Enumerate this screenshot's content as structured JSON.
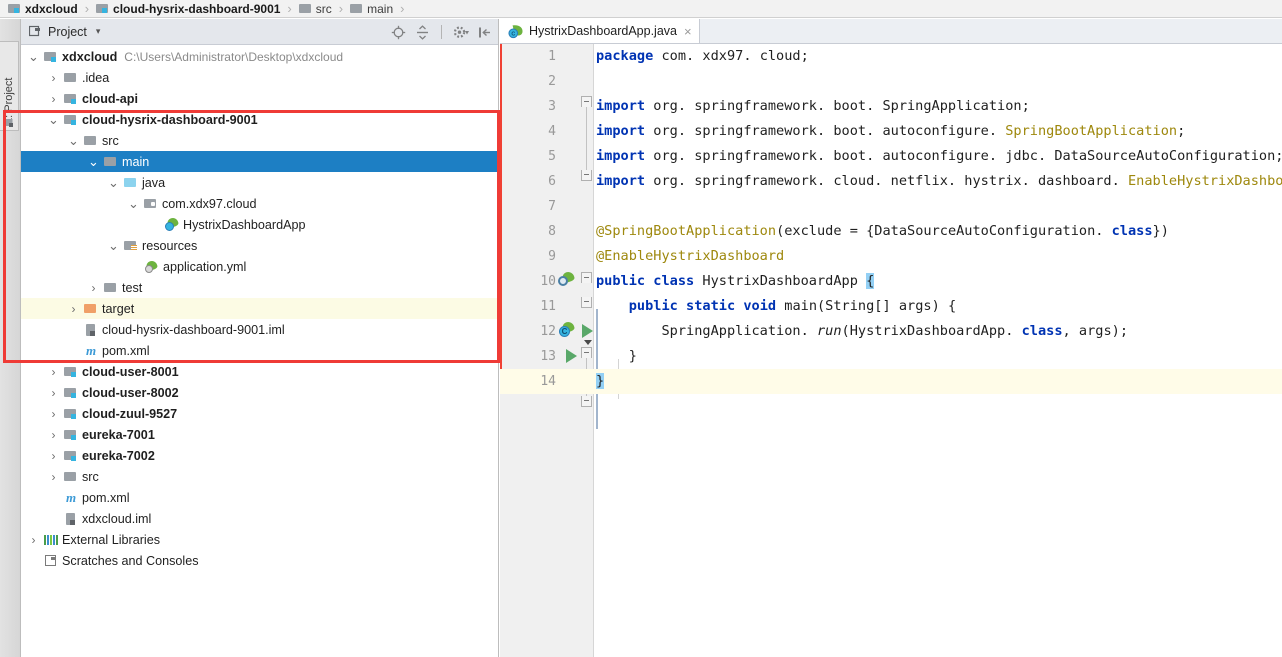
{
  "breadcrumb": {
    "name": "breadcrumb",
    "items": [
      {
        "label": "xdxcloud",
        "icon": "module-icon",
        "bold": true
      },
      {
        "label": "cloud-hysrix-dashboard-9001",
        "icon": "module-icon",
        "bold": true
      },
      {
        "label": "src",
        "icon": "folder-icon",
        "bold": false
      },
      {
        "label": "main",
        "icon": "folder-icon",
        "bold": false
      }
    ],
    "separator": "›"
  },
  "toolwindow_tab": {
    "label": "1: Project",
    "icon": "project-icon"
  },
  "project_panel": {
    "title": "Project",
    "caret": "▾",
    "tools": [
      {
        "name": "locate-icon",
        "title": "Select Opened File"
      },
      {
        "name": "collapse-all-icon",
        "title": "Collapse All"
      },
      {
        "name": "settings-gear-icon",
        "title": "Settings"
      },
      {
        "name": "hide-panel-icon",
        "title": "Hide"
      }
    ]
  },
  "tree": {
    "rows": [
      {
        "indent": 0,
        "arrow": "⌄",
        "icon": "module-icon",
        "label": "xdxcloud",
        "bold": true,
        "sub": "C:\\Users\\Administrator\\Desktop\\xdxcloud",
        "state": "normal"
      },
      {
        "indent": 1,
        "arrow": "›",
        "icon": "folder-icon",
        "label": ".idea",
        "bold": false,
        "sub": "",
        "state": "normal"
      },
      {
        "indent": 1,
        "arrow": "›",
        "icon": "module-icon",
        "label": "cloud-api",
        "bold": true,
        "sub": "",
        "state": "normal"
      },
      {
        "indent": 1,
        "arrow": "⌄",
        "icon": "module-icon",
        "label": "cloud-hysrix-dashboard-9001",
        "bold": true,
        "sub": "",
        "state": "normal"
      },
      {
        "indent": 2,
        "arrow": "⌄",
        "icon": "folder-icon",
        "label": "src",
        "bold": false,
        "sub": "",
        "state": "normal"
      },
      {
        "indent": 3,
        "arrow": "⌄",
        "icon": "folder-icon",
        "label": "main",
        "bold": false,
        "sub": "",
        "state": "selected"
      },
      {
        "indent": 4,
        "arrow": "⌄",
        "icon": "source-folder-icon",
        "label": "java",
        "bold": false,
        "sub": "",
        "state": "normal"
      },
      {
        "indent": 5,
        "arrow": "⌄",
        "icon": "package-icon",
        "label": "com.xdx97.cloud",
        "bold": false,
        "sub": "",
        "state": "normal"
      },
      {
        "indent": 6,
        "arrow": "",
        "icon": "spring-class-icon",
        "label": "HystrixDashboardApp",
        "bold": false,
        "sub": "",
        "state": "normal"
      },
      {
        "indent": 4,
        "arrow": "⌄",
        "icon": "resource-folder-icon",
        "label": "resources",
        "bold": false,
        "sub": "",
        "state": "normal"
      },
      {
        "indent": 5,
        "arrow": "",
        "icon": "spring-yml-icon",
        "label": "application.yml",
        "bold": false,
        "sub": "",
        "state": "normal"
      },
      {
        "indent": 3,
        "arrow": "›",
        "icon": "folder-icon",
        "label": "test",
        "bold": false,
        "sub": "",
        "state": "normal"
      },
      {
        "indent": 2,
        "arrow": "›",
        "icon": "target-folder-icon",
        "label": "target",
        "bold": false,
        "sub": "",
        "state": "highlight"
      },
      {
        "indent": 2,
        "arrow": "",
        "icon": "iml-file-icon",
        "label": "cloud-hysrix-dashboard-9001.iml",
        "bold": false,
        "sub": "",
        "state": "normal"
      },
      {
        "indent": 2,
        "arrow": "",
        "icon": "maven-file-icon",
        "label": "pom.xml",
        "bold": false,
        "sub": "",
        "state": "normal"
      },
      {
        "indent": 1,
        "arrow": "›",
        "icon": "module-icon",
        "label": "cloud-user-8001",
        "bold": true,
        "sub": "",
        "state": "normal"
      },
      {
        "indent": 1,
        "arrow": "›",
        "icon": "module-icon",
        "label": "cloud-user-8002",
        "bold": true,
        "sub": "",
        "state": "normal"
      },
      {
        "indent": 1,
        "arrow": "›",
        "icon": "module-icon",
        "label": "cloud-zuul-9527",
        "bold": true,
        "sub": "",
        "state": "normal"
      },
      {
        "indent": 1,
        "arrow": "›",
        "icon": "module-icon",
        "label": "eureka-7001",
        "bold": true,
        "sub": "",
        "state": "normal"
      },
      {
        "indent": 1,
        "arrow": "›",
        "icon": "module-icon",
        "label": "eureka-7002",
        "bold": true,
        "sub": "",
        "state": "normal"
      },
      {
        "indent": 1,
        "arrow": "›",
        "icon": "folder-icon",
        "label": "src",
        "bold": false,
        "sub": "",
        "state": "normal"
      },
      {
        "indent": 1,
        "arrow": "",
        "icon": "maven-file-icon",
        "label": "pom.xml",
        "bold": false,
        "sub": "",
        "state": "normal"
      },
      {
        "indent": 1,
        "arrow": "",
        "icon": "iml-file-icon",
        "label": "xdxcloud.iml",
        "bold": false,
        "sub": "",
        "state": "normal"
      },
      {
        "indent": 0,
        "arrow": "›",
        "icon": "external-libraries-icon",
        "label": "External Libraries",
        "bold": false,
        "sub": "",
        "state": "normal"
      },
      {
        "indent": 0,
        "arrow": "",
        "icon": "scratches-icon",
        "label": "Scratches and Consoles",
        "bold": false,
        "sub": "",
        "state": "normal"
      }
    ]
  },
  "annotation": {
    "name": "red-highlight-rectangle",
    "color": "#ef3b36"
  },
  "editor": {
    "tabs": [
      {
        "label": "HystrixDashboardApp.java",
        "icon": "spring-class-icon",
        "close": "×",
        "active": true
      }
    ],
    "current_line": 14,
    "lines": [
      {
        "no": 1,
        "segments": [
          {
            "t": "package",
            "c": "kw"
          },
          {
            "t": " com. xdx97. cloud;",
            "c": ""
          }
        ]
      },
      {
        "no": 2,
        "segments": []
      },
      {
        "no": 3,
        "segments": [
          {
            "t": "import",
            "c": "kw"
          },
          {
            "t": " org. springframework. boot. SpringApplication;",
            "c": ""
          }
        ]
      },
      {
        "no": 4,
        "segments": [
          {
            "t": "import",
            "c": "kw"
          },
          {
            "t": " org. springframework. boot. autoconfigure. ",
            "c": ""
          },
          {
            "t": "SpringBootApplication",
            "c": "cls"
          },
          {
            "t": ";",
            "c": ""
          }
        ]
      },
      {
        "no": 5,
        "segments": [
          {
            "t": "import",
            "c": "kw"
          },
          {
            "t": " org. springframework. boot. autoconfigure. jdbc. DataSourceAutoConfiguration;",
            "c": ""
          }
        ]
      },
      {
        "no": 6,
        "segments": [
          {
            "t": "import",
            "c": "kw"
          },
          {
            "t": " org. springframework. cloud. netflix. hystrix. dashboard. ",
            "c": ""
          },
          {
            "t": "EnableHystrixDashboard",
            "c": "cls"
          },
          {
            "t": ";",
            "c": ""
          }
        ]
      },
      {
        "no": 7,
        "segments": []
      },
      {
        "no": 8,
        "segments": [
          {
            "t": "@SpringBootApplication",
            "c": "ann"
          },
          {
            "t": "(exclude = ",
            "c": ""
          },
          {
            "t": "{",
            "c": "brace"
          },
          {
            "t": "DataSourceAutoConfiguration. ",
            "c": ""
          },
          {
            "t": "class",
            "c": "kw"
          },
          {
            "t": "}",
            "c": "brace"
          },
          {
            "t": ")",
            "c": ""
          }
        ]
      },
      {
        "no": 9,
        "segments": [
          {
            "t": "@EnableHystrixDashboard",
            "c": "ann"
          }
        ]
      },
      {
        "no": 10,
        "segments": [
          {
            "t": "public class",
            "c": "kw"
          },
          {
            "t": " HystrixDashboardApp ",
            "c": ""
          },
          {
            "t": "{",
            "c": "brace-hl"
          }
        ]
      },
      {
        "no": 11,
        "segments": [
          {
            "t": "    ",
            "c": ""
          },
          {
            "t": "public static void",
            "c": "kw"
          },
          {
            "t": " main(String[] args) {",
            "c": ""
          }
        ]
      },
      {
        "no": 12,
        "segments": [
          {
            "t": "        SpringApplication. ",
            "c": ""
          },
          {
            "t": "run",
            "c": "ital"
          },
          {
            "t": "(HystrixDashboardApp. ",
            "c": ""
          },
          {
            "t": "class",
            "c": "kw"
          },
          {
            "t": ", args);",
            "c": ""
          }
        ]
      },
      {
        "no": 13,
        "segments": [
          {
            "t": "    }",
            "c": ""
          }
        ]
      },
      {
        "no": 14,
        "segments": [
          {
            "t": "}",
            "c": "brace-hl"
          }
        ]
      }
    ],
    "gutter_icons": [
      {
        "line": 8,
        "name": "spring-bean-search-gutter-icon"
      },
      {
        "line": 10,
        "name": "spring-config-gutter-icon"
      },
      {
        "line": 10,
        "name": "run-application-gutter-icon"
      },
      {
        "line": 11,
        "name": "run-method-gutter-icon"
      }
    ]
  }
}
